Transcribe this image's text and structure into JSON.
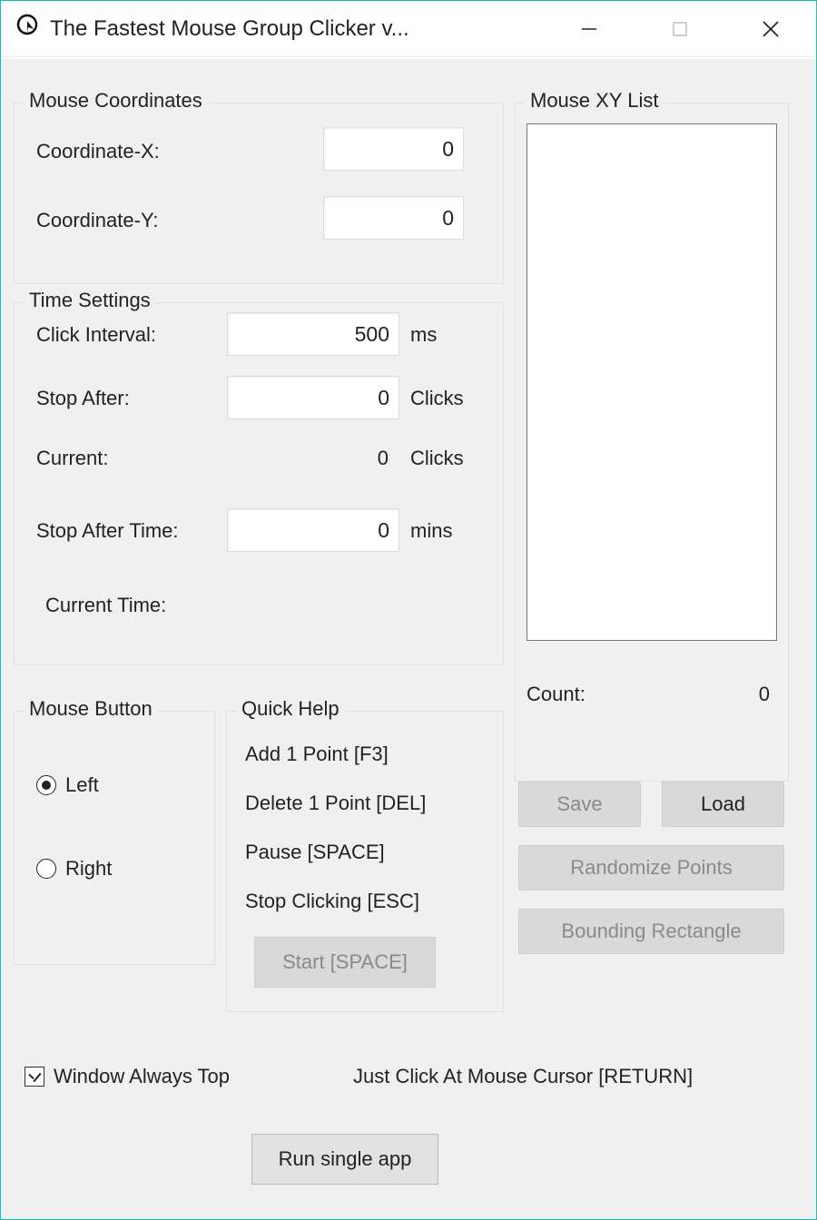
{
  "window": {
    "title": "The Fastest Mouse Group Clicker v..."
  },
  "coords": {
    "legend": "Mouse Coordinates",
    "x_label": "Coordinate-X:",
    "x_value": "0",
    "y_label": "Coordinate-Y:",
    "y_value": "0"
  },
  "time": {
    "legend": "Time Settings",
    "interval_label": "Click Interval:",
    "interval_value": "500",
    "interval_unit": "ms",
    "stop_after_label": "Stop After:",
    "stop_after_value": "0",
    "stop_after_unit": "Clicks",
    "current_label": "Current:",
    "current_value": "0",
    "current_unit": "Clicks",
    "stop_after_time_label": "Stop After Time:",
    "stop_after_time_value": "0",
    "stop_after_time_unit": "mins",
    "current_time_label": "Current Time:",
    "current_time_value": ""
  },
  "mouse_button": {
    "legend": "Mouse Button",
    "left_label": "Left",
    "right_label": "Right",
    "selected": "left"
  },
  "quick_help": {
    "legend": "Quick Help",
    "items": [
      "Add 1 Point [F3]",
      "Delete 1 Point [DEL]",
      "Pause [SPACE]",
      "Stop Clicking [ESC]"
    ],
    "start_label": "Start [SPACE]"
  },
  "xy_list": {
    "legend": "Mouse XY List",
    "count_label": "Count:",
    "count_value": "0",
    "save_label": "Save",
    "load_label": "Load",
    "randomize_label": "Randomize Points",
    "bounding_label": "Bounding Rectangle"
  },
  "footer": {
    "always_top_label": "Window Always Top",
    "always_top_checked": true,
    "just_click_label": "Just Click At Mouse Cursor [RETURN]",
    "run_single_label": "Run single app"
  }
}
